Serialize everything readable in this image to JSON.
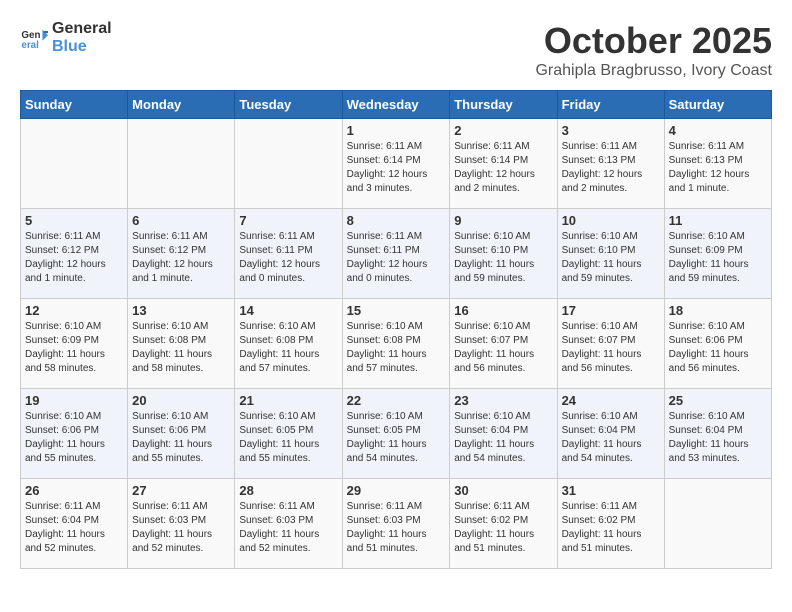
{
  "logo": {
    "line1": "General",
    "line2": "Blue"
  },
  "header": {
    "month": "October 2025",
    "location": "Grahipla Bragbrusso, Ivory Coast"
  },
  "weekdays": [
    "Sunday",
    "Monday",
    "Tuesday",
    "Wednesday",
    "Thursday",
    "Friday",
    "Saturday"
  ],
  "weeks": [
    [
      {
        "day": "",
        "info": ""
      },
      {
        "day": "",
        "info": ""
      },
      {
        "day": "",
        "info": ""
      },
      {
        "day": "1",
        "info": "Sunrise: 6:11 AM\nSunset: 6:14 PM\nDaylight: 12 hours and 3 minutes."
      },
      {
        "day": "2",
        "info": "Sunrise: 6:11 AM\nSunset: 6:14 PM\nDaylight: 12 hours and 2 minutes."
      },
      {
        "day": "3",
        "info": "Sunrise: 6:11 AM\nSunset: 6:13 PM\nDaylight: 12 hours and 2 minutes."
      },
      {
        "day": "4",
        "info": "Sunrise: 6:11 AM\nSunset: 6:13 PM\nDaylight: 12 hours and 1 minute."
      }
    ],
    [
      {
        "day": "5",
        "info": "Sunrise: 6:11 AM\nSunset: 6:12 PM\nDaylight: 12 hours and 1 minute."
      },
      {
        "day": "6",
        "info": "Sunrise: 6:11 AM\nSunset: 6:12 PM\nDaylight: 12 hours and 1 minute."
      },
      {
        "day": "7",
        "info": "Sunrise: 6:11 AM\nSunset: 6:11 PM\nDaylight: 12 hours and 0 minutes."
      },
      {
        "day": "8",
        "info": "Sunrise: 6:11 AM\nSunset: 6:11 PM\nDaylight: 12 hours and 0 minutes."
      },
      {
        "day": "9",
        "info": "Sunrise: 6:10 AM\nSunset: 6:10 PM\nDaylight: 11 hours and 59 minutes."
      },
      {
        "day": "10",
        "info": "Sunrise: 6:10 AM\nSunset: 6:10 PM\nDaylight: 11 hours and 59 minutes."
      },
      {
        "day": "11",
        "info": "Sunrise: 6:10 AM\nSunset: 6:09 PM\nDaylight: 11 hours and 59 minutes."
      }
    ],
    [
      {
        "day": "12",
        "info": "Sunrise: 6:10 AM\nSunset: 6:09 PM\nDaylight: 11 hours and 58 minutes."
      },
      {
        "day": "13",
        "info": "Sunrise: 6:10 AM\nSunset: 6:08 PM\nDaylight: 11 hours and 58 minutes."
      },
      {
        "day": "14",
        "info": "Sunrise: 6:10 AM\nSunset: 6:08 PM\nDaylight: 11 hours and 57 minutes."
      },
      {
        "day": "15",
        "info": "Sunrise: 6:10 AM\nSunset: 6:08 PM\nDaylight: 11 hours and 57 minutes."
      },
      {
        "day": "16",
        "info": "Sunrise: 6:10 AM\nSunset: 6:07 PM\nDaylight: 11 hours and 56 minutes."
      },
      {
        "day": "17",
        "info": "Sunrise: 6:10 AM\nSunset: 6:07 PM\nDaylight: 11 hours and 56 minutes."
      },
      {
        "day": "18",
        "info": "Sunrise: 6:10 AM\nSunset: 6:06 PM\nDaylight: 11 hours and 56 minutes."
      }
    ],
    [
      {
        "day": "19",
        "info": "Sunrise: 6:10 AM\nSunset: 6:06 PM\nDaylight: 11 hours and 55 minutes."
      },
      {
        "day": "20",
        "info": "Sunrise: 6:10 AM\nSunset: 6:06 PM\nDaylight: 11 hours and 55 minutes."
      },
      {
        "day": "21",
        "info": "Sunrise: 6:10 AM\nSunset: 6:05 PM\nDaylight: 11 hours and 55 minutes."
      },
      {
        "day": "22",
        "info": "Sunrise: 6:10 AM\nSunset: 6:05 PM\nDaylight: 11 hours and 54 minutes."
      },
      {
        "day": "23",
        "info": "Sunrise: 6:10 AM\nSunset: 6:04 PM\nDaylight: 11 hours and 54 minutes."
      },
      {
        "day": "24",
        "info": "Sunrise: 6:10 AM\nSunset: 6:04 PM\nDaylight: 11 hours and 54 minutes."
      },
      {
        "day": "25",
        "info": "Sunrise: 6:10 AM\nSunset: 6:04 PM\nDaylight: 11 hours and 53 minutes."
      }
    ],
    [
      {
        "day": "26",
        "info": "Sunrise: 6:11 AM\nSunset: 6:04 PM\nDaylight: 11 hours and 52 minutes."
      },
      {
        "day": "27",
        "info": "Sunrise: 6:11 AM\nSunset: 6:03 PM\nDaylight: 11 hours and 52 minutes."
      },
      {
        "day": "28",
        "info": "Sunrise: 6:11 AM\nSunset: 6:03 PM\nDaylight: 11 hours and 52 minutes."
      },
      {
        "day": "29",
        "info": "Sunrise: 6:11 AM\nSunset: 6:03 PM\nDaylight: 11 hours and 51 minutes."
      },
      {
        "day": "30",
        "info": "Sunrise: 6:11 AM\nSunset: 6:02 PM\nDaylight: 11 hours and 51 minutes."
      },
      {
        "day": "31",
        "info": "Sunrise: 6:11 AM\nSunset: 6:02 PM\nDaylight: 11 hours and 51 minutes."
      },
      {
        "day": "",
        "info": ""
      }
    ]
  ]
}
